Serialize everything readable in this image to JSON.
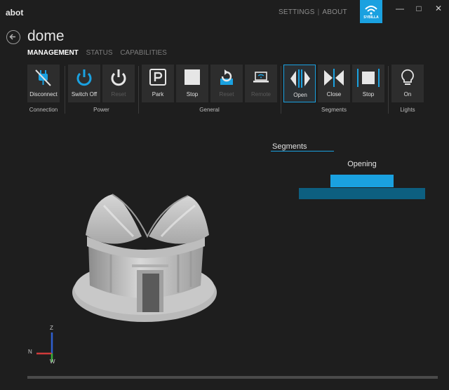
{
  "window": {
    "title": "abot",
    "links": [
      "SETTINGS",
      "ABOUT"
    ],
    "brand": "SYBILLA",
    "controls": [
      "—",
      "□",
      "✕"
    ]
  },
  "page": {
    "title": "dome",
    "nav": [
      "MANAGEMENT",
      "STATUS",
      "CAPABILITIES"
    ]
  },
  "ribbon": {
    "connection": {
      "label": "Connection",
      "buttons": [
        "Disconnect"
      ]
    },
    "power": {
      "label": "Power",
      "buttons": [
        "Switch Off",
        "Reset"
      ]
    },
    "general": {
      "label": "General",
      "buttons": [
        "Park",
        "Stop",
        "Reset",
        "Remote"
      ]
    },
    "segments": {
      "label": "Segments",
      "buttons": [
        "Open",
        "Close",
        "Stop"
      ]
    },
    "lights": {
      "label": "Lights",
      "buttons": [
        "On"
      ]
    }
  },
  "segments_panel": {
    "title": "Segments",
    "status": "Opening"
  },
  "axes": {
    "z": "Z",
    "n": "N",
    "w": "W"
  },
  "colors": {
    "accent": "#1aa1e0",
    "accent_dark": "#0d5f80",
    "background": "#1e1e1e"
  }
}
